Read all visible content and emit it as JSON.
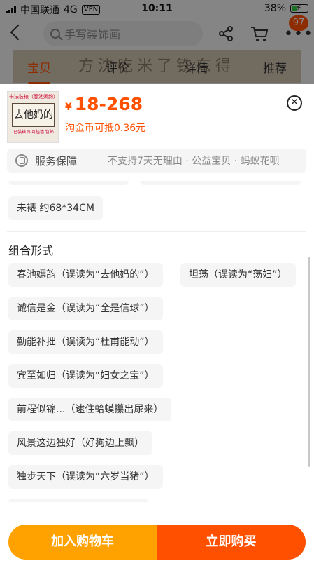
{
  "status_bar": {
    "carrier": "中国联通",
    "network": "4G",
    "vpn": "VPN",
    "time": "10:11",
    "battery": "38%",
    "battery_level": 0.38
  },
  "nav": {
    "search_placeholder": "手写装饰画",
    "badge_count": "97",
    "more_label": "•••"
  },
  "tabs": [
    {
      "label": "宝贝",
      "active": true
    },
    {
      "label": "评价",
      "active": false
    },
    {
      "label": "详情",
      "active": false
    },
    {
      "label": "推荐",
      "active": false
    }
  ],
  "banner_text": "方沈吃米了铁东得",
  "sheet": {
    "thumbnail": {
      "top_text": "书法装裱（春池嫣韵）",
      "art_text": "去他妈的",
      "bottom_text": "已装裱 即可挂墙 包邮"
    },
    "price_currency": "¥",
    "price": "18-268",
    "coin_text": "淘金币可抵0.36元",
    "close_label": "✕",
    "service_label": "服务保障",
    "service_text": "不支持7天无理由 · 公益宝贝 · 蚂蚁花呗",
    "size_option": "未裱 约68*34CM",
    "section_title": "组合形式",
    "options": [
      "春池嫣韵（误读为“去他妈的”）",
      "坦荡（误读为“荡妇”）",
      "诚信是金（误读为“全是信球”）",
      "勤能补拙（误读为“杜甫能动”）",
      "宾至如归（误读为“妇女之宝”）",
      "前程似锦...（逮住蛤蟆攥出尿来）",
      "风景这边独好（好狗边上飘）",
      "独步天下（误读为“六岁当猪”）"
    ]
  },
  "buttons": {
    "add_cart": "加入购物车",
    "buy_now": "立即购买"
  },
  "colors": {
    "accent": "#ff5000",
    "cart_button": "#ffa200",
    "buy_button": "#ff5000"
  }
}
